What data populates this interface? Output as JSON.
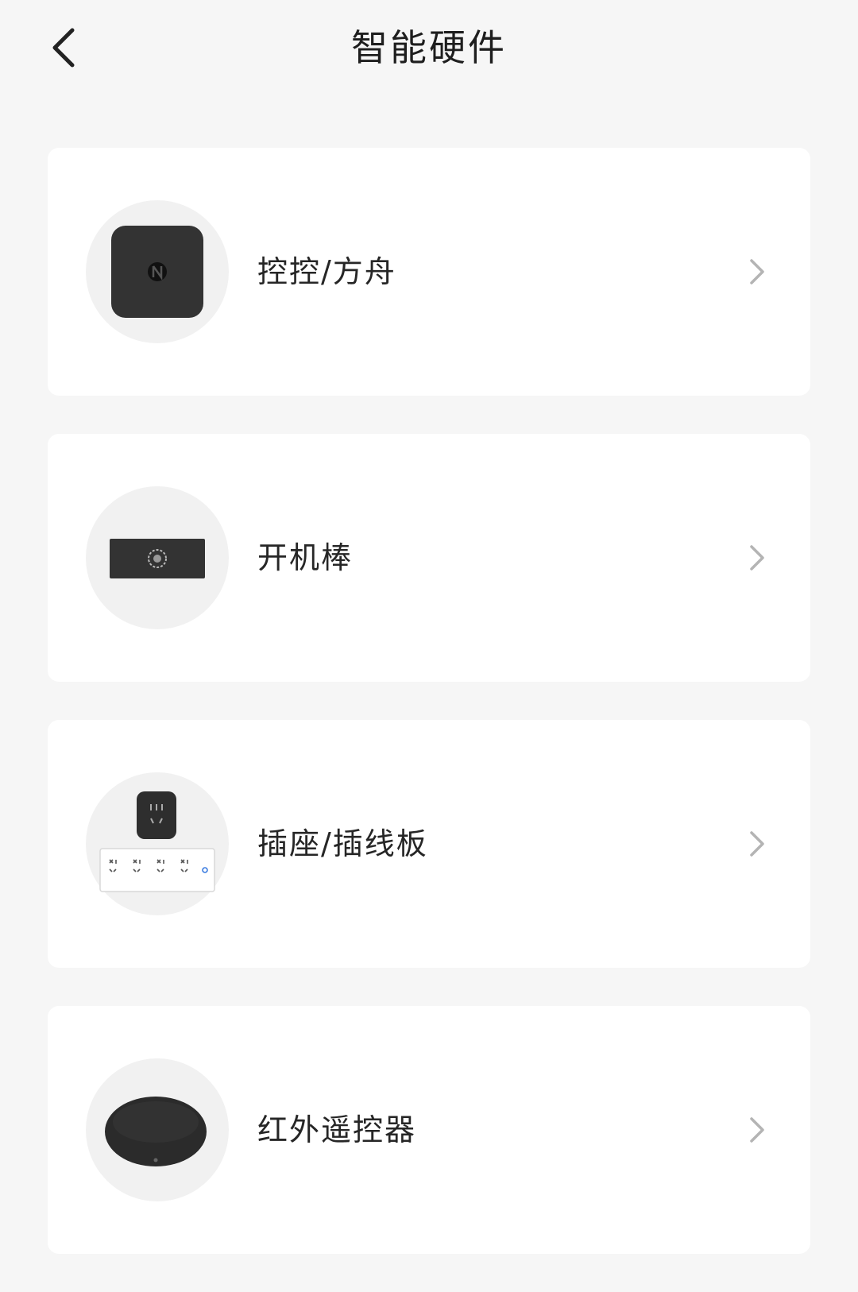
{
  "header": {
    "back_icon": "chevron-left-icon",
    "title": "智能硬件"
  },
  "devices": [
    {
      "label": "控控/方舟",
      "image": "square-box-device",
      "chevron_icon": "chevron-right-icon"
    },
    {
      "label": "开机棒",
      "image": "boot-stick-device",
      "chevron_icon": "chevron-right-icon"
    },
    {
      "label": "插座/插线板",
      "image": "socket-power-strip-device",
      "chevron_icon": "chevron-right-icon"
    },
    {
      "label": "红外遥控器",
      "image": "ir-remote-device",
      "chevron_icon": "chevron-right-icon"
    }
  ],
  "colors": {
    "background": "#f6f6f6",
    "card": "#ffffff",
    "text": "#262626",
    "chevron": "#b4b4b4",
    "device_dark": "#333333"
  }
}
